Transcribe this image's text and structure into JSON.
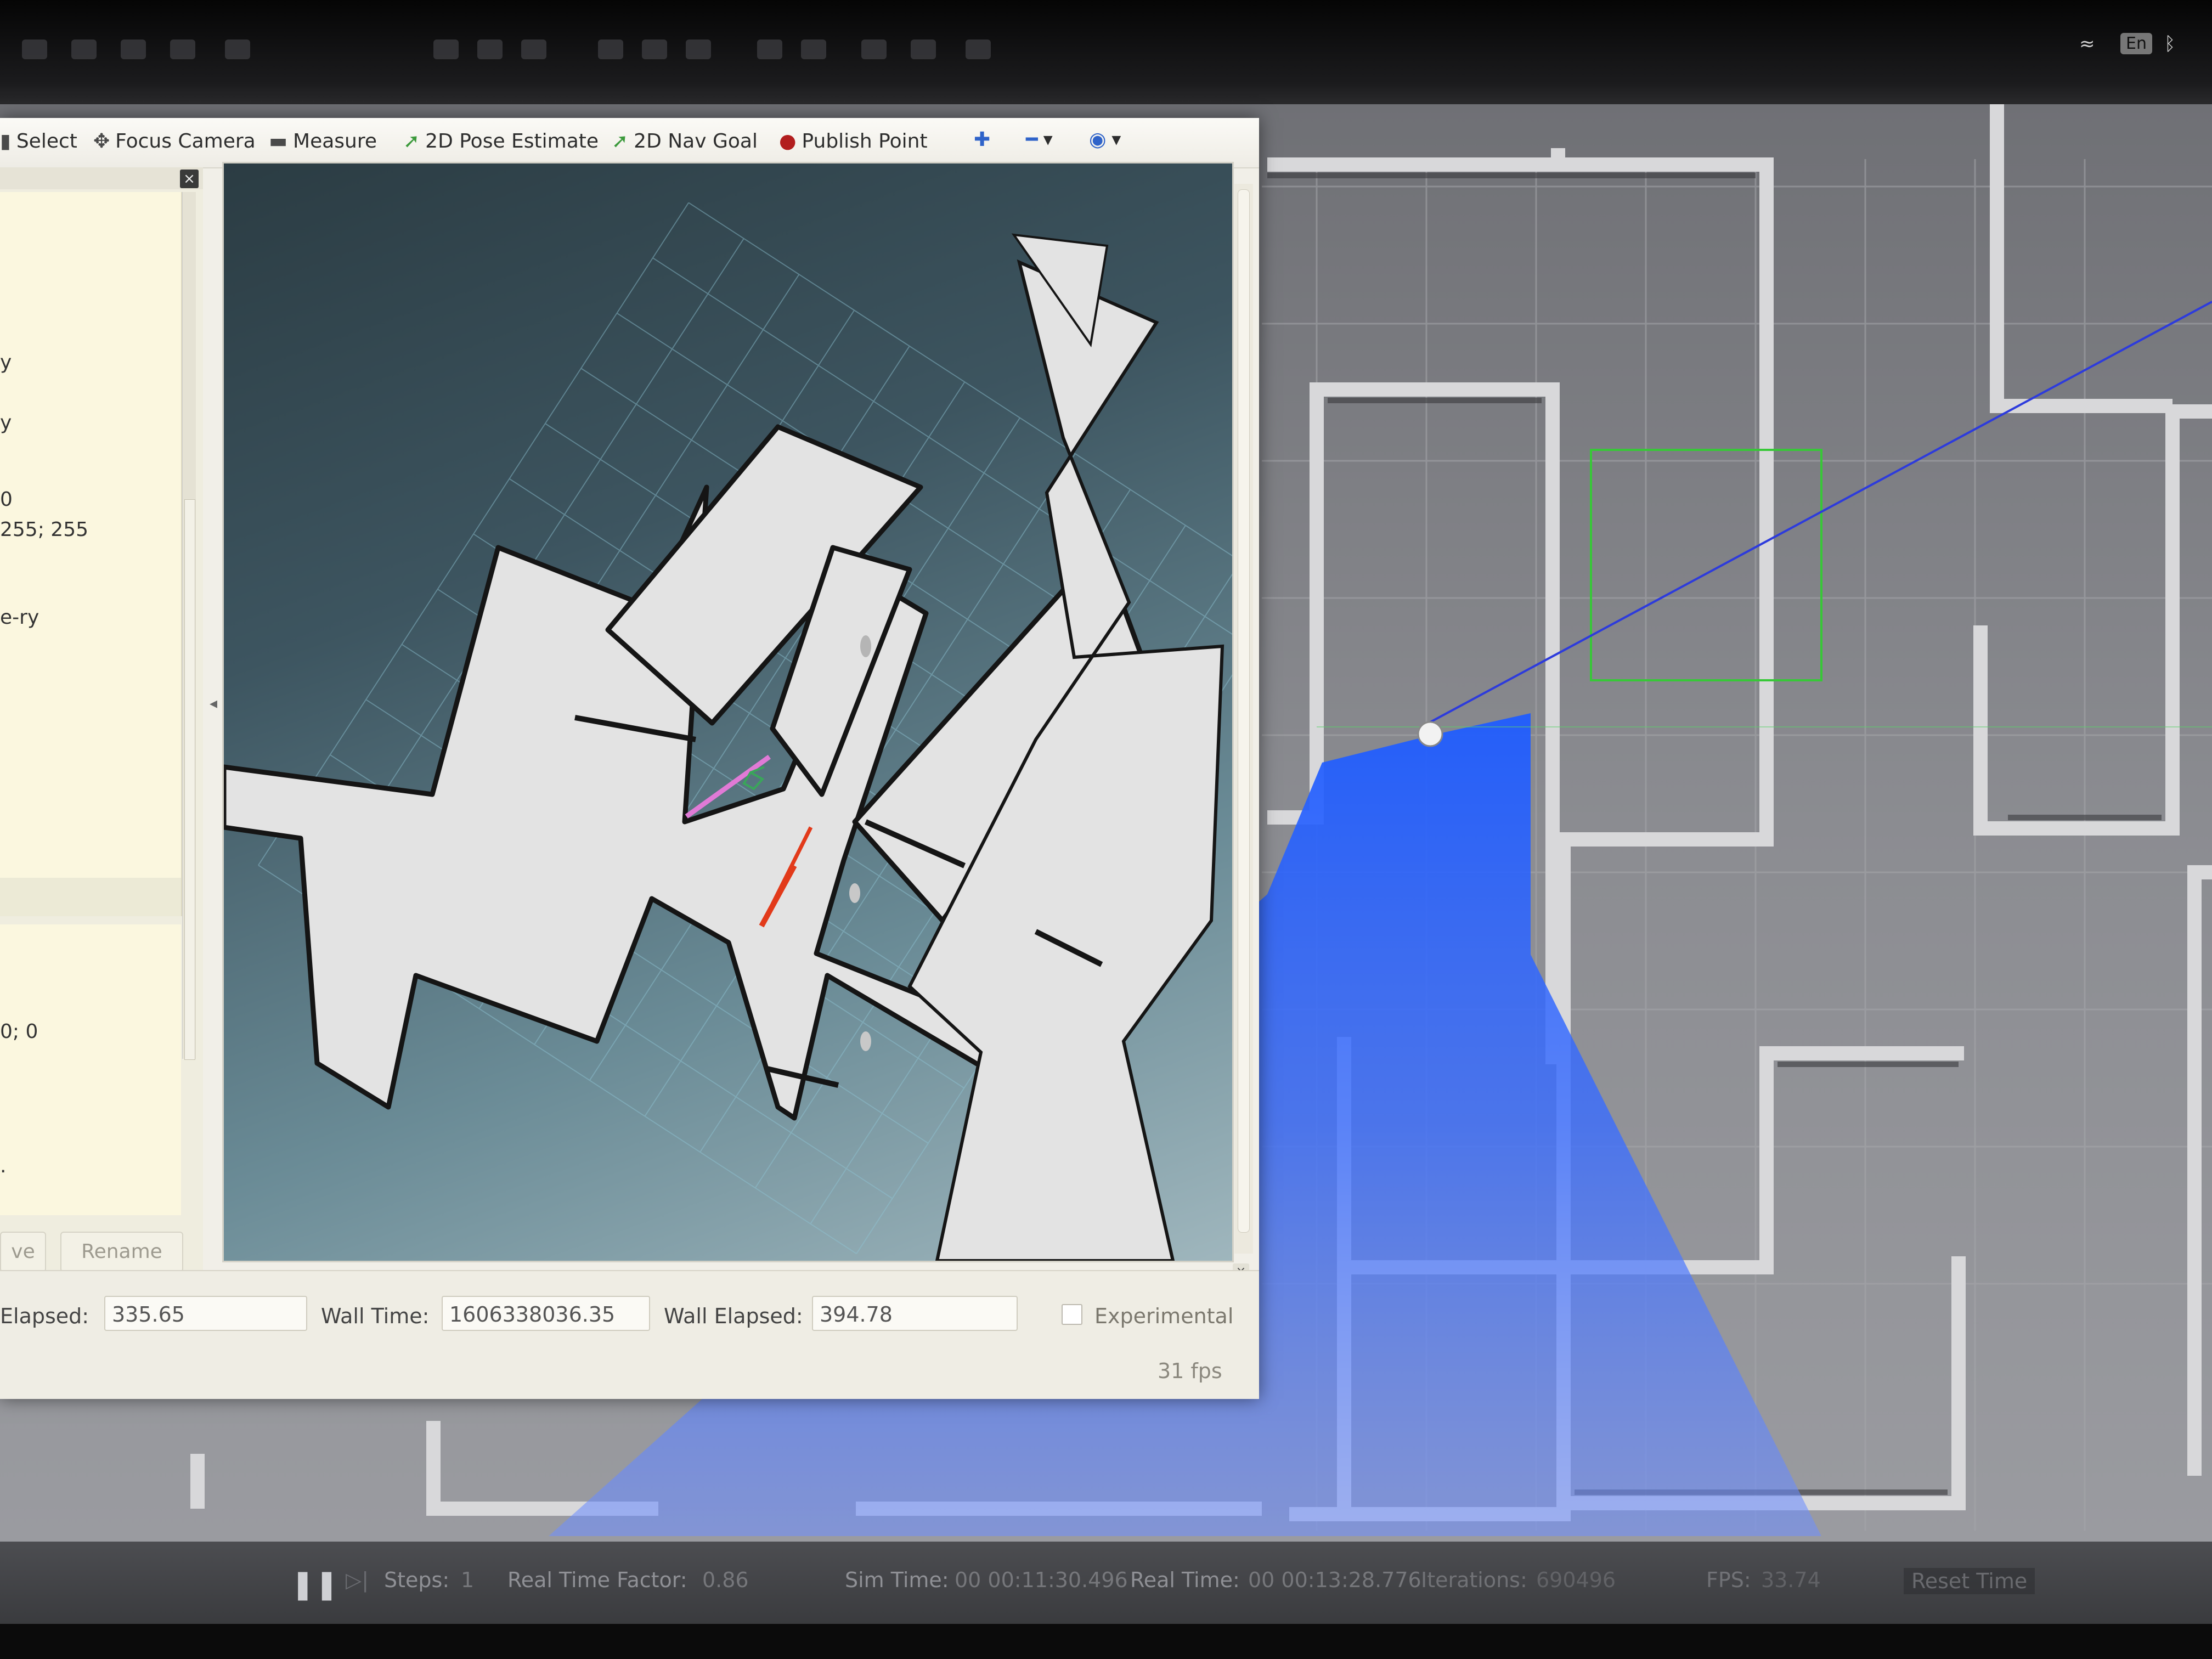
{
  "system_tray": {
    "language": "En"
  },
  "rviz": {
    "toolbar": {
      "select": "Select",
      "focus_camera": "Focus Camera",
      "measure": "Measure",
      "pose_estimate": "2D Pose Estimate",
      "nav_goal": "2D Nav Goal",
      "publish_point": "Publish Point"
    },
    "properties_partial": [
      "y",
      "y",
      "0",
      "255; 255",
      "e-ry",
      "0; 0",
      "."
    ],
    "buttons": {
      "remove_partial": "ve",
      "rename": "Rename"
    },
    "time": {
      "ros_elapsed_label": "Elapsed:",
      "ros_elapsed_value": "335.65",
      "wall_time_label": "Wall Time:",
      "wall_time_value": "1606338036.35",
      "wall_elapsed_label": "Wall Elapsed:",
      "wall_elapsed_value": "394.78",
      "experimental_label": "Experimental",
      "fps": "31 fps"
    }
  },
  "gazebo_bottom": {
    "steps_label": "Steps:",
    "steps_value": "1",
    "rtf_label": "Real Time Factor:",
    "rtf_value": "0.86",
    "sim_time_label": "Sim Time:",
    "sim_time_value": "00 00:11:30.496",
    "real_time_label": "Real Time:",
    "real_time_value": "00 00:13:28.776",
    "iterations_label": "Iterations:",
    "iterations_value": "690496",
    "fps_label": "FPS:",
    "fps_value": "33.74",
    "reset_label": "Reset Time"
  },
  "colors": {
    "scan_blue": "#1f5cff",
    "map_free": "#e2e2e2",
    "map_wall": "#1a1a1a",
    "path_red": "#e23a1a",
    "goal_pink": "#e07ad6"
  }
}
